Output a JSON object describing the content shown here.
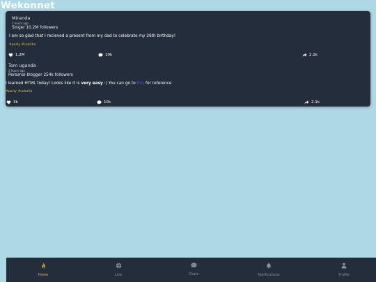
{
  "app": {
    "brand": "Wekonnet"
  },
  "posts": [
    {
      "author": "Miranda",
      "time": "2 hours ago",
      "meta": "Singer 10.2M followers",
      "body": "I am so glad that I recieved a present from my dad to celebrate my 26th birthday!",
      "tags": "#party #colorful",
      "likes": "1.2M",
      "comments": "10k",
      "shares": "2.1k"
    },
    {
      "author": "Tom uganda",
      "time": "2 hours ago",
      "meta": "Personal blogger 254k followers",
      "body_prefix": "I learned HTML today! Looks like it is ",
      "body_bold": "very easy",
      "body_mid": " :) You can go to ",
      "body_link": "this",
      "body_suffix": " for reference",
      "tags": "#party #colorful",
      "likes": "3k",
      "comments": "10k",
      "shares": "2.1k"
    }
  ],
  "nav": {
    "items": [
      {
        "label": "Home",
        "icon": "flame-icon",
        "active": true
      },
      {
        "label": "Live",
        "icon": "globe-icon",
        "active": false
      },
      {
        "label": "Chats",
        "icon": "chat-bubble-icon",
        "active": false
      },
      {
        "label": "Notifications",
        "icon": "bell-icon",
        "active": false
      },
      {
        "label": "Profile",
        "icon": "user-icon",
        "active": false
      }
    ]
  },
  "colors": {
    "background": "#add8e6",
    "card": "#232d3b",
    "tag": "#e0c23a",
    "active_nav": "#f0b429",
    "inactive_nav": "#8a93a3",
    "link": "#3a5ccc"
  }
}
